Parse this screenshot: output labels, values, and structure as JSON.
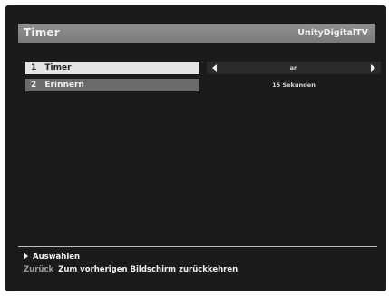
{
  "header": {
    "title": "Timer",
    "brand": "UnityDigitalTV"
  },
  "menu": {
    "items": [
      {
        "number": "1",
        "label": "Timer",
        "value": "an",
        "selected": true
      },
      {
        "number": "2",
        "label": "Erinnern",
        "value": "15 Sekunden",
        "selected": false
      }
    ]
  },
  "footer": {
    "select_label": "Auswählen",
    "back_key": "Zurück",
    "back_description": "Zum vorherigen Bildschirm zurückkehren"
  },
  "icons": {
    "left": "chevron-left-icon",
    "right": "chevron-right-icon",
    "select": "play-icon"
  },
  "colors": {
    "background": "#1b1b1b",
    "title_bar": "#858585",
    "selected_row": "#e4e4e4",
    "normal_row": "#6b6b6b",
    "text": "#f2f2f2"
  }
}
